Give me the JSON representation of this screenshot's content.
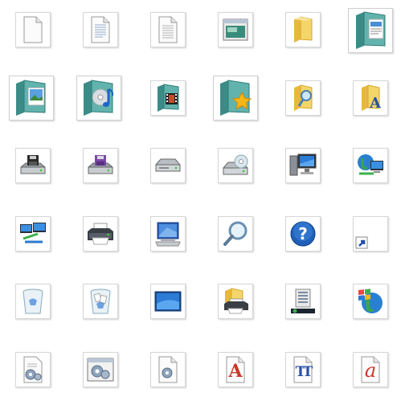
{
  "colors": {
    "tile_border": "#d6d6d6",
    "folder_yellow": "#f2cf57",
    "folder_teal": "#3f8f8a",
    "accent_blue": "#2c6fd1",
    "help_blue": "#1f5fb8",
    "font_red": "#c83a2a",
    "font_blue": "#2a4fa8",
    "star_gold": "#f5b617"
  },
  "icons": [
    {
      "name": "blank-document-icon"
    },
    {
      "name": "text-document-icon"
    },
    {
      "name": "lined-document-icon"
    },
    {
      "name": "application-window-icon"
    },
    {
      "name": "yellow-folder-icon"
    },
    {
      "name": "documents-folder-icon"
    },
    {
      "name": "pictures-folder-icon"
    },
    {
      "name": "music-folder-icon"
    },
    {
      "name": "videos-folder-icon"
    },
    {
      "name": "favorites-folder-icon"
    },
    {
      "name": "search-folder-icon"
    },
    {
      "name": "fonts-folder-icon"
    },
    {
      "name": "floppy-drive-icon"
    },
    {
      "name": "floppy-drive-purple-icon"
    },
    {
      "name": "hard-drive-icon"
    },
    {
      "name": "cd-drive-icon"
    },
    {
      "name": "computer-icon"
    },
    {
      "name": "internet-network-icon"
    },
    {
      "name": "network-computers-icon"
    },
    {
      "name": "printer-icon"
    },
    {
      "name": "control-panel-icon"
    },
    {
      "name": "magnifier-icon"
    },
    {
      "name": "help-icon"
    },
    {
      "name": "shortcut-arrow-icon"
    },
    {
      "name": "recycle-bin-empty-icon"
    },
    {
      "name": "recycle-bin-full-icon"
    },
    {
      "name": "desktop-screen-icon"
    },
    {
      "name": "printers-folder-icon"
    },
    {
      "name": "start-menu-icon"
    },
    {
      "name": "windows-globe-icon"
    },
    {
      "name": "settings-document-icon"
    },
    {
      "name": "settings-window-icon"
    },
    {
      "name": "system-file-icon"
    },
    {
      "name": "opentype-font-icon",
      "glyph": "A"
    },
    {
      "name": "truetype-font-icon",
      "glyph": "TT"
    },
    {
      "name": "raster-font-icon",
      "glyph": "a"
    }
  ]
}
